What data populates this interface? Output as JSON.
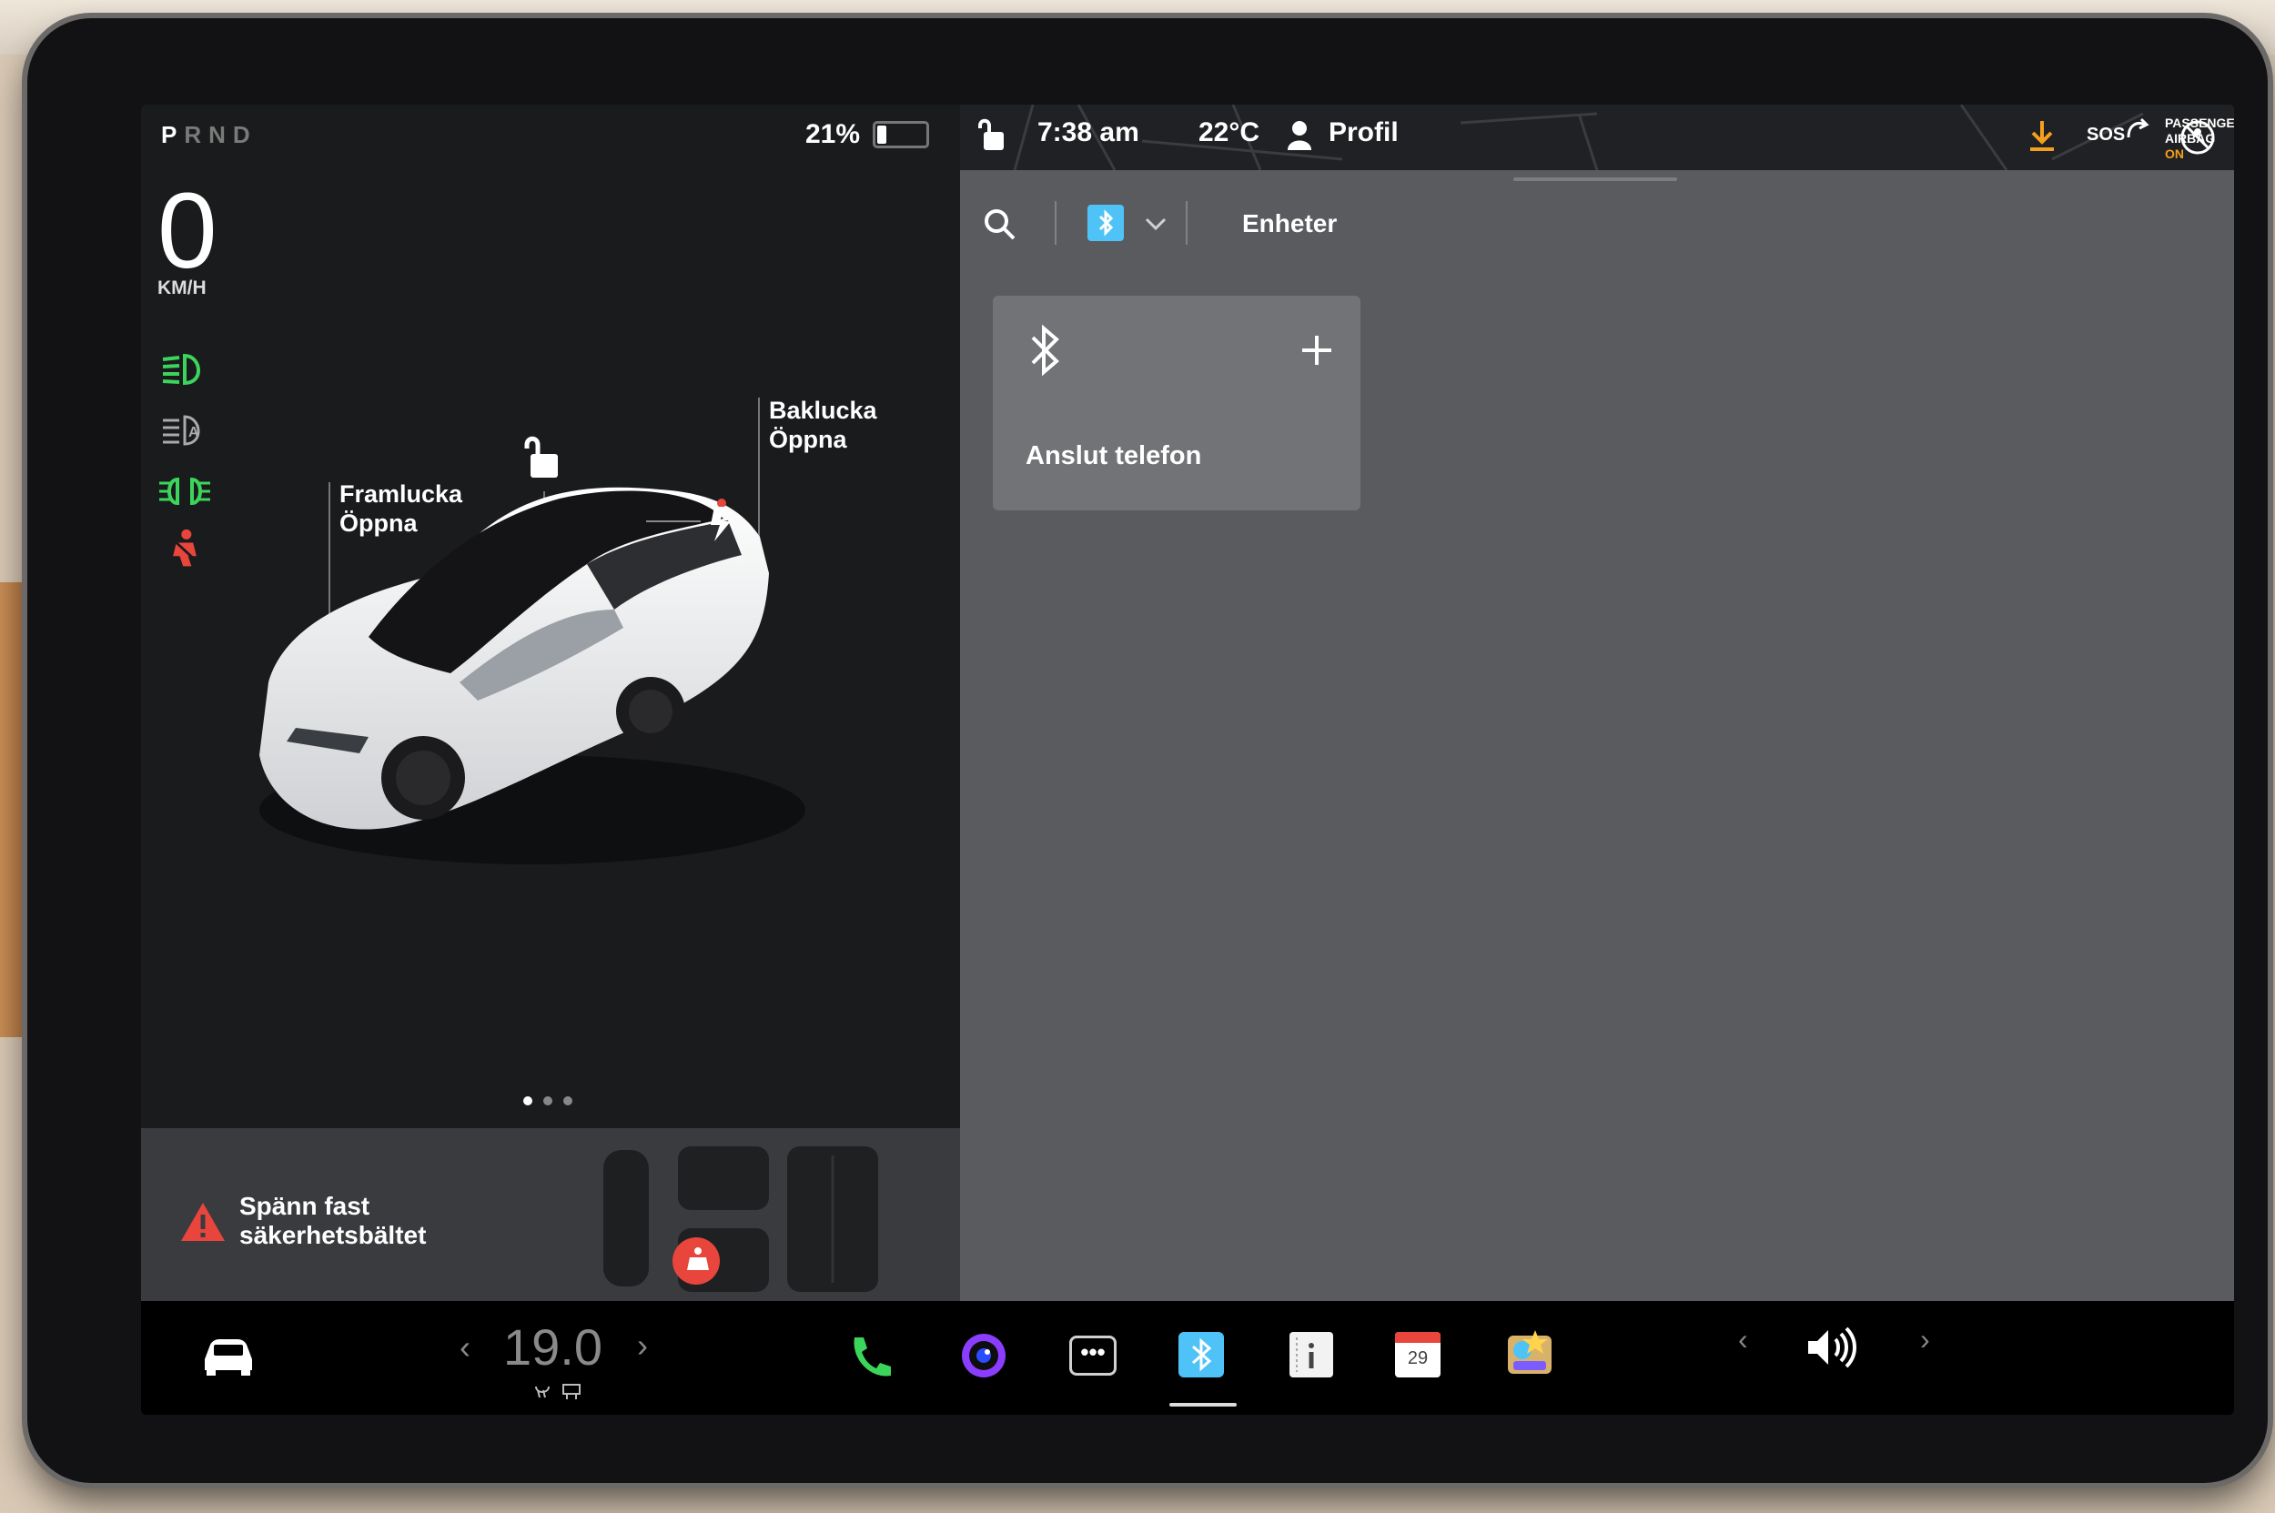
{
  "gear": {
    "p": "P",
    "rnd": "RND"
  },
  "battery": {
    "percent": "21%",
    "level": 0.21
  },
  "speed": {
    "value": "0",
    "unit": "KM/H"
  },
  "car_labels": {
    "front_trunk": "Framlucka",
    "front_trunk_action": "Öppna",
    "rear_trunk": "Baklucka",
    "rear_trunk_action": "Öppna"
  },
  "alert": {
    "line1": "Spänn fast",
    "line2": "säkerhetsbältet"
  },
  "status_bar": {
    "time": "7:38 am",
    "temperature": "22°C",
    "profile": "Profil",
    "sos": "SOS",
    "airbag_line1": "PASSENGER",
    "airbag_line2": "AIRBAG",
    "airbag_state": "ON"
  },
  "bluetooth_panel": {
    "tab_label": "Enheter",
    "card_label": "Anslut telefon"
  },
  "dock": {
    "cabin_temperature": "19.0",
    "calendar_day": "29"
  },
  "colors": {
    "green_indicator": "#3cd55b",
    "red_indicator": "#e8453c",
    "bluetooth_tile": "#4fc3f7",
    "download_orange": "#f4a01c"
  }
}
